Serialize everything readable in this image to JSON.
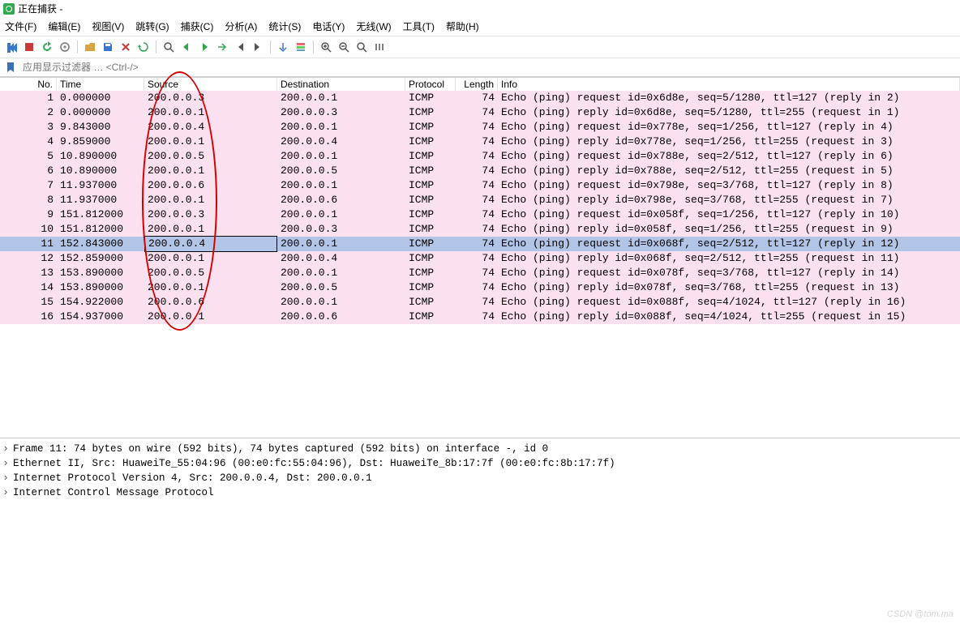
{
  "window": {
    "title": "正在捕获 -"
  },
  "menu": {
    "file": "文件(F)",
    "edit": "编辑(E)",
    "view": "视图(V)",
    "go": "跳转(G)",
    "capture": "捕获(C)",
    "analyze": "分析(A)",
    "statistics": "统计(S)",
    "telephony": "电话(Y)",
    "wireless": "无线(W)",
    "tools": "工具(T)",
    "help": "帮助(H)"
  },
  "filter": {
    "placeholder": "应用显示过滤器 … <Ctrl-/>"
  },
  "columns": {
    "no": "No.",
    "time": "Time",
    "source": "Source",
    "destination": "Destination",
    "protocol": "Protocol",
    "length": "Length",
    "info": "Info"
  },
  "packets": [
    {
      "no": "1",
      "time": "0.000000",
      "src": "200.0.0.3",
      "dst": "200.0.0.1",
      "proto": "ICMP",
      "len": "74",
      "info": "Echo (ping) request  id=0x6d8e, seq=5/1280, ttl=127 (reply in 2)",
      "cls": "req"
    },
    {
      "no": "2",
      "time": "0.000000",
      "src": "200.0.0.1",
      "dst": "200.0.0.3",
      "proto": "ICMP",
      "len": "74",
      "info": "Echo (ping) reply    id=0x6d8e, seq=5/1280, ttl=255 (request in 1)",
      "cls": "rep"
    },
    {
      "no": "3",
      "time": "9.843000",
      "src": "200.0.0.4",
      "dst": "200.0.0.1",
      "proto": "ICMP",
      "len": "74",
      "info": "Echo (ping) request  id=0x778e, seq=1/256, ttl=127 (reply in 4)",
      "cls": "req"
    },
    {
      "no": "4",
      "time": "9.859000",
      "src": "200.0.0.1",
      "dst": "200.0.0.4",
      "proto": "ICMP",
      "len": "74",
      "info": "Echo (ping) reply    id=0x778e, seq=1/256, ttl=255 (request in 3)",
      "cls": "rep"
    },
    {
      "no": "5",
      "time": "10.890000",
      "src": "200.0.0.5",
      "dst": "200.0.0.1",
      "proto": "ICMP",
      "len": "74",
      "info": "Echo (ping) request  id=0x788e, seq=2/512, ttl=127 (reply in 6)",
      "cls": "req"
    },
    {
      "no": "6",
      "time": "10.890000",
      "src": "200.0.0.1",
      "dst": "200.0.0.5",
      "proto": "ICMP",
      "len": "74",
      "info": "Echo (ping) reply    id=0x788e, seq=2/512, ttl=255 (request in 5)",
      "cls": "rep"
    },
    {
      "no": "7",
      "time": "11.937000",
      "src": "200.0.0.6",
      "dst": "200.0.0.1",
      "proto": "ICMP",
      "len": "74",
      "info": "Echo (ping) request  id=0x798e, seq=3/768, ttl=127 (reply in 8)",
      "cls": "req"
    },
    {
      "no": "8",
      "time": "11.937000",
      "src": "200.0.0.1",
      "dst": "200.0.0.6",
      "proto": "ICMP",
      "len": "74",
      "info": "Echo (ping) reply    id=0x798e, seq=3/768, ttl=255 (request in 7)",
      "cls": "rep"
    },
    {
      "no": "9",
      "time": "151.812000",
      "src": "200.0.0.3",
      "dst": "200.0.0.1",
      "proto": "ICMP",
      "len": "74",
      "info": "Echo (ping) request  id=0x058f, seq=1/256, ttl=127 (reply in 10)",
      "cls": "req"
    },
    {
      "no": "10",
      "time": "151.812000",
      "src": "200.0.0.1",
      "dst": "200.0.0.3",
      "proto": "ICMP",
      "len": "74",
      "info": "Echo (ping) reply    id=0x058f, seq=1/256, ttl=255 (request in 9)",
      "cls": "rep"
    },
    {
      "no": "11",
      "time": "152.843000",
      "src": "200.0.0.4",
      "dst": "200.0.0.1",
      "proto": "ICMP",
      "len": "74",
      "info": "Echo (ping) request  id=0x068f, seq=2/512, ttl=127 (reply in 12)",
      "cls": "sel"
    },
    {
      "no": "12",
      "time": "152.859000",
      "src": "200.0.0.1",
      "dst": "200.0.0.4",
      "proto": "ICMP",
      "len": "74",
      "info": "Echo (ping) reply    id=0x068f, seq=2/512, ttl=255 (request in 11)",
      "cls": "rep"
    },
    {
      "no": "13",
      "time": "153.890000",
      "src": "200.0.0.5",
      "dst": "200.0.0.1",
      "proto": "ICMP",
      "len": "74",
      "info": "Echo (ping) request  id=0x078f, seq=3/768, ttl=127 (reply in 14)",
      "cls": "req"
    },
    {
      "no": "14",
      "time": "153.890000",
      "src": "200.0.0.1",
      "dst": "200.0.0.5",
      "proto": "ICMP",
      "len": "74",
      "info": "Echo (ping) reply    id=0x078f, seq=3/768, ttl=255 (request in 13)",
      "cls": "rep"
    },
    {
      "no": "15",
      "time": "154.922000",
      "src": "200.0.0.6",
      "dst": "200.0.0.1",
      "proto": "ICMP",
      "len": "74",
      "info": "Echo (ping) request  id=0x088f, seq=4/1024, ttl=127 (reply in 16)",
      "cls": "req"
    },
    {
      "no": "16",
      "time": "154.937000",
      "src": "200.0.0.1",
      "dst": "200.0.0.6",
      "proto": "ICMP",
      "len": "74",
      "info": "Echo (ping) reply    id=0x088f, seq=4/1024, ttl=255 (request in 15)",
      "cls": "rep"
    }
  ],
  "details": {
    "line1": "Frame 11: 74 bytes on wire (592 bits), 74 bytes captured (592 bits) on interface -, id 0",
    "line2": "Ethernet II, Src: HuaweiTe_55:04:96 (00:e0:fc:55:04:96), Dst: HuaweiTe_8b:17:7f (00:e0:fc:8b:17:7f)",
    "line3": "Internet Protocol Version 4, Src: 200.0.0.4, Dst: 200.0.0.1",
    "line4": "Internet Control Message Protocol"
  },
  "watermark": "CSDN @tom.ma"
}
